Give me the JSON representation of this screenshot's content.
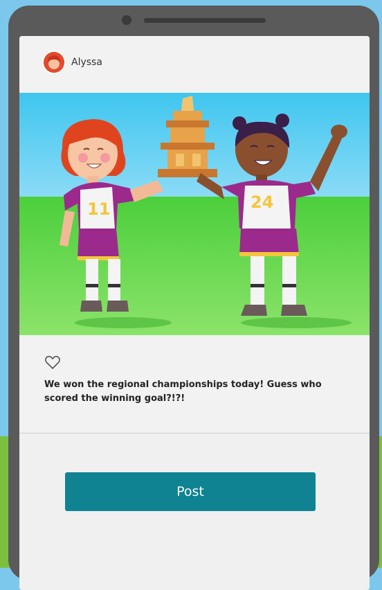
{
  "post": {
    "author": "Alyssa",
    "caption": "We won the regional championships today! Guess who scored the winning goal?!?!",
    "jersey_left": "11",
    "jersey_right": "24"
  },
  "actions": {
    "post_label": "Post"
  },
  "icons": {
    "like": "heart-outline-icon",
    "avatar": "avatar-red-hair"
  },
  "colors": {
    "button": "#0f8392",
    "avatar": "#e24b2f",
    "sky": "#7ed0f0",
    "grass": "#6fd34c"
  }
}
